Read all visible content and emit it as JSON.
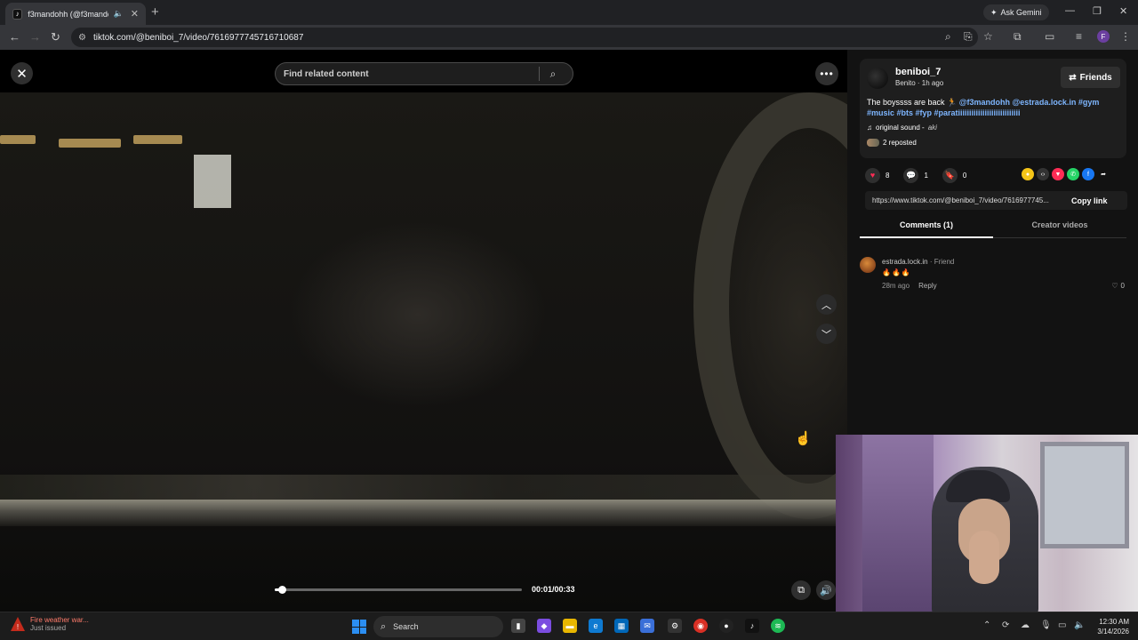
{
  "browser": {
    "tab_title": "f3mandohh (@f3mandohh) ...",
    "tab_favicon": "tiktok-icon",
    "new_tab_label": "+",
    "ask_gemini": "Ask Gemini",
    "url": "tiktok.com/@beniboi_7/video/7616977745716710687"
  },
  "video": {
    "search_placeholder": "Find related content",
    "time": "00:01/00:33",
    "progress": 0.03
  },
  "post": {
    "author": "beniboi_7",
    "author_sub": "Benito · 1h ago",
    "friends_button": "Friends",
    "desc_text": "The boyssss are back 🏃 ",
    "desc_tags": "@f3mandohh @estrada.lock.in #gym #music #bts #fyp #parati",
    "desc_tail": "iiiiiiiiiiiiiiiiiiiiiiiiiii",
    "sound": "original sound - ",
    "sound_artist": "aki",
    "reposted": "2 reposted",
    "likes": "8",
    "comments": "1",
    "saves": "0",
    "link": "https://www.tiktok.com/@beniboi_7/video/7616977745...",
    "copy_link": "Copy link",
    "tab_comments": "Comments (1)",
    "tab_creator": "Creator videos"
  },
  "comments": [
    {
      "user": "estrada.lock.in",
      "badge": " · Friend",
      "text": "🔥🔥🔥",
      "time": "28m ago",
      "reply": "Reply",
      "likes": "0"
    }
  ],
  "taskbar": {
    "weather_title": "Fire weather war...",
    "weather_sub": "Just issued",
    "search_label": "Search",
    "time": "12:30 AM",
    "date": "3/14/2026"
  },
  "colors": {
    "accent_tag": "#7eb6ff",
    "like_red": "#fe2c55",
    "panel_bg": "#121212"
  }
}
